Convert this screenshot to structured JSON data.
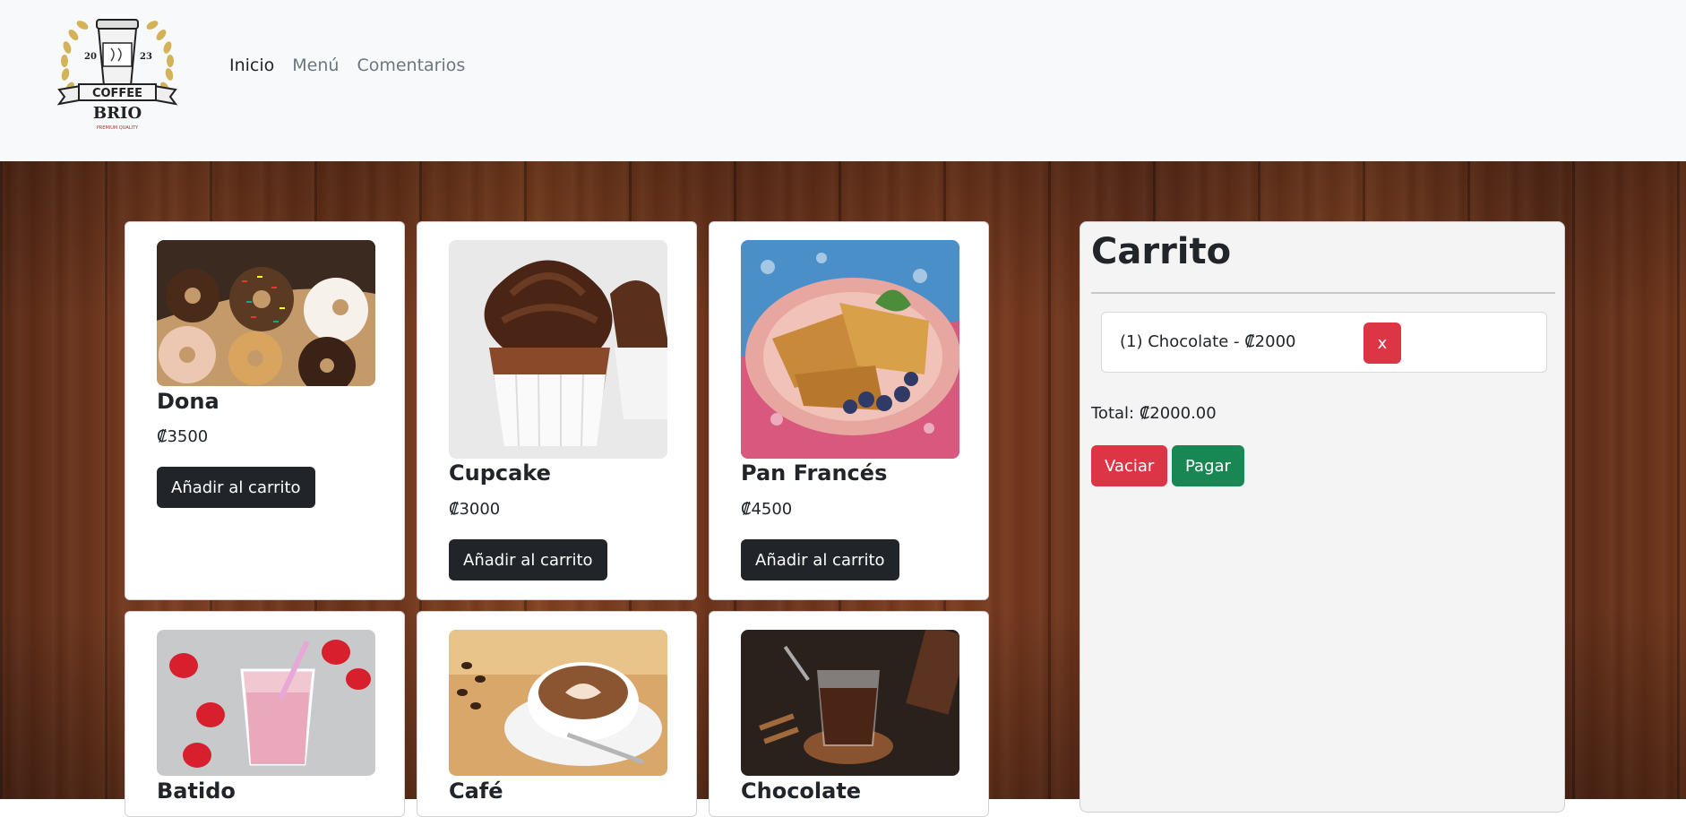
{
  "brand": {
    "logo_text": "COFFEE",
    "logo_name": "BRIO",
    "logo_tagline": "PREMIUM QUALITY",
    "logo_year_left": "20",
    "logo_year_right": "23"
  },
  "nav": {
    "items": [
      {
        "label": "Inicio"
      },
      {
        "label": "Menú"
      },
      {
        "label": "Comentarios"
      }
    ]
  },
  "products": [
    {
      "name": "Dona",
      "price": "₡3500",
      "button": "Añadir al carrito"
    },
    {
      "name": "Cupcake",
      "price": "₡3000",
      "button": "Añadir al carrito"
    },
    {
      "name": "Pan Francés",
      "price": "₡4500",
      "button": "Añadir al carrito"
    },
    {
      "name": "Batido"
    },
    {
      "name": "Café"
    },
    {
      "name": "Chocolate"
    }
  ],
  "cart": {
    "title": "Carrito",
    "items": [
      {
        "text": "(1) Chocolate - ₡2000",
        "remove": "x"
      }
    ],
    "total": "Total: ₡2000.00",
    "empty_label": "Vaciar",
    "pay_label": "Pagar"
  },
  "colors": {
    "danger": "#dc3545",
    "success": "#198754",
    "dark": "#212529",
    "navbar_bg": "#f8f9fa"
  }
}
